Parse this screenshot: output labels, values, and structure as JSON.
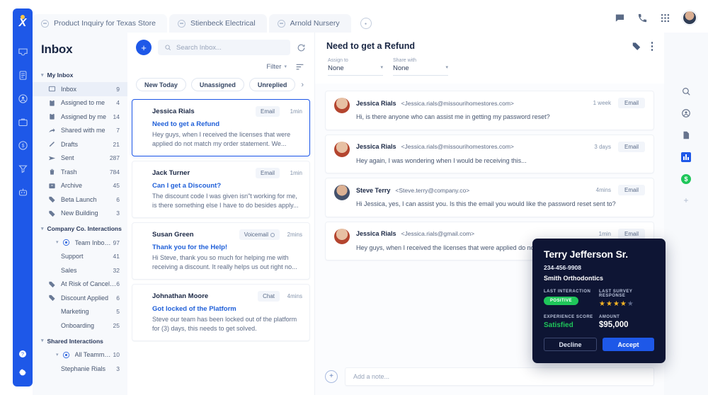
{
  "tabs": [
    {
      "label": "Product Inquiry for Texas Store",
      "active": true
    },
    {
      "label": "Stienbeck Electrical",
      "active": false
    },
    {
      "label": "Arnold Nursery",
      "active": false
    }
  ],
  "sidebar": {
    "title": "Inbox",
    "groups": [
      {
        "label": "My Inbox",
        "items": [
          {
            "label": "Inbox",
            "count": "9",
            "icon": "inbox-icon",
            "selected": true
          },
          {
            "label": "Assigned to me",
            "count": "4",
            "icon": "assigned-to-icon"
          },
          {
            "label": "Assigned by me",
            "count": "14",
            "icon": "assigned-by-icon"
          },
          {
            "label": "Shared with me",
            "count": "7",
            "icon": "share-icon"
          },
          {
            "label": "Drafts",
            "count": "21",
            "icon": "pencil-icon"
          },
          {
            "label": "Sent",
            "count": "287",
            "icon": "send-icon"
          },
          {
            "label": "Trash",
            "count": "784",
            "icon": "trash-icon"
          },
          {
            "label": "Archive",
            "count": "45",
            "icon": "archive-icon"
          },
          {
            "label": "Beta Launch",
            "count": "6",
            "icon": "tag-icon"
          },
          {
            "label": "New Building",
            "count": "3",
            "icon": "tag-icon"
          }
        ]
      },
      {
        "label": "Company Co. Interactions",
        "items": [
          {
            "label": "Team Inboxes",
            "count": "97",
            "icon": "team-icon",
            "nested": true
          },
          {
            "label": "Support",
            "count": "41",
            "icon": "none",
            "nested2": true
          },
          {
            "label": "Sales",
            "count": "32",
            "icon": "none",
            "nested2": true
          },
          {
            "label": "At Risk of Cancelling",
            "count": "6",
            "icon": "tag-icon"
          },
          {
            "label": "Discount Applied",
            "count": "6",
            "icon": "tag-icon"
          },
          {
            "label": "Marketing",
            "count": "5",
            "icon": "none",
            "nested2": true
          },
          {
            "label": "Onboarding",
            "count": "25",
            "icon": "none",
            "nested2": true
          }
        ]
      },
      {
        "label": "Shared Interactions",
        "items": [
          {
            "label": "All Teammates",
            "count": "10",
            "icon": "team-icon",
            "nested": true
          },
          {
            "label": "Stephanie Rials",
            "count": "3",
            "icon": "none",
            "nested2": true
          }
        ]
      }
    ]
  },
  "list": {
    "search_placeholder": "Search Inbox...",
    "filter_label": "Filter",
    "chips": [
      "New Today",
      "Unassigned",
      "Unreplied"
    ],
    "conversations": [
      {
        "name": "Jessica Rials",
        "channel": "Email",
        "time": "1min",
        "subject": "Need to get a Refund",
        "preview": "Hey guys, when I received the licenses that were applied do not match my order statement. We...",
        "active": true
      },
      {
        "name": "Jack Turner",
        "channel": "Email",
        "time": "1min",
        "subject": "Can I get a Discount?",
        "preview": "The discount code I was given isn\"t working for me, is there something else I have to do besides apply...",
        "active": false
      },
      {
        "name": "Susan Green",
        "channel": "Voicemail",
        "time": "2mins",
        "subject": "Thank you for the Help!",
        "preview": "Hi Steve, thank you so much for helping me with receiving a discount. It really helps us out right no...",
        "active": false,
        "has_dot": true
      },
      {
        "name": "Johnathan Moore",
        "channel": "Chat",
        "time": "4mins",
        "subject": "Got locked of the Platform",
        "preview": "Steve our team has been locked out of the platform for (3) days, this needs to get solved.",
        "active": false
      }
    ]
  },
  "main": {
    "title": "Need to get a Refund",
    "assign_to_label": "Assign to",
    "assign_to_value": "None",
    "share_with_label": "Share with",
    "share_with_value": "None",
    "messages": [
      {
        "name": "Jessica Rials",
        "email": "<Jessica.rials@missourihomestores.com>",
        "time": "1 week",
        "channel": "Email",
        "text": "Hi, is there anyone who can assist me in getting my password reset?",
        "avatar": "female"
      },
      {
        "name": "Jessica Rials",
        "email": "<Jessica.rials@missourihomestores.com>",
        "time": "3 days",
        "channel": "Email",
        "text": "Hey again, I was wondering when I would be receiving this...",
        "avatar": "female"
      },
      {
        "name": "Steve Terry",
        "email": "<Steve.terry@company.co>",
        "time": "4mins",
        "channel": "Email",
        "text": "Hi Jessica, yes, I can assist you.  Is this the email you would like the password reset sent to?",
        "avatar": "male"
      },
      {
        "name": "Jessica Rials",
        "email": "<Jessica.rials@gmail.com>",
        "time": "1min",
        "channel": "Email",
        "text": "Hey guys, when I received the licenses that were applied do not match my order statement...",
        "avatar": "female"
      }
    ],
    "note_placeholder": "Add a note..."
  },
  "contact_card": {
    "name": "Terry Jefferson Sr.",
    "phone": "234-456-9908",
    "organization": "Smith Orthodontics",
    "last_interaction_label": "LAST INTERACTION",
    "last_interaction_value": "POSITIVE",
    "last_survey_label": "LAST SURVEY RESPONSE",
    "stars_filled": 4,
    "stars_total": 5,
    "experience_label": "EXPERIENCE SCORE",
    "experience_value": "Satisfied",
    "amount_label": "AMOUNT",
    "amount_value": "$95,000",
    "decline_label": "Decline",
    "accept_label": "Accept"
  },
  "colors": {
    "brand_blue": "#1e58e8",
    "link_blue": "#1f5fd8",
    "card_navy": "#0e1534",
    "green": "#1fc65a",
    "star_gold": "#f5b425"
  }
}
